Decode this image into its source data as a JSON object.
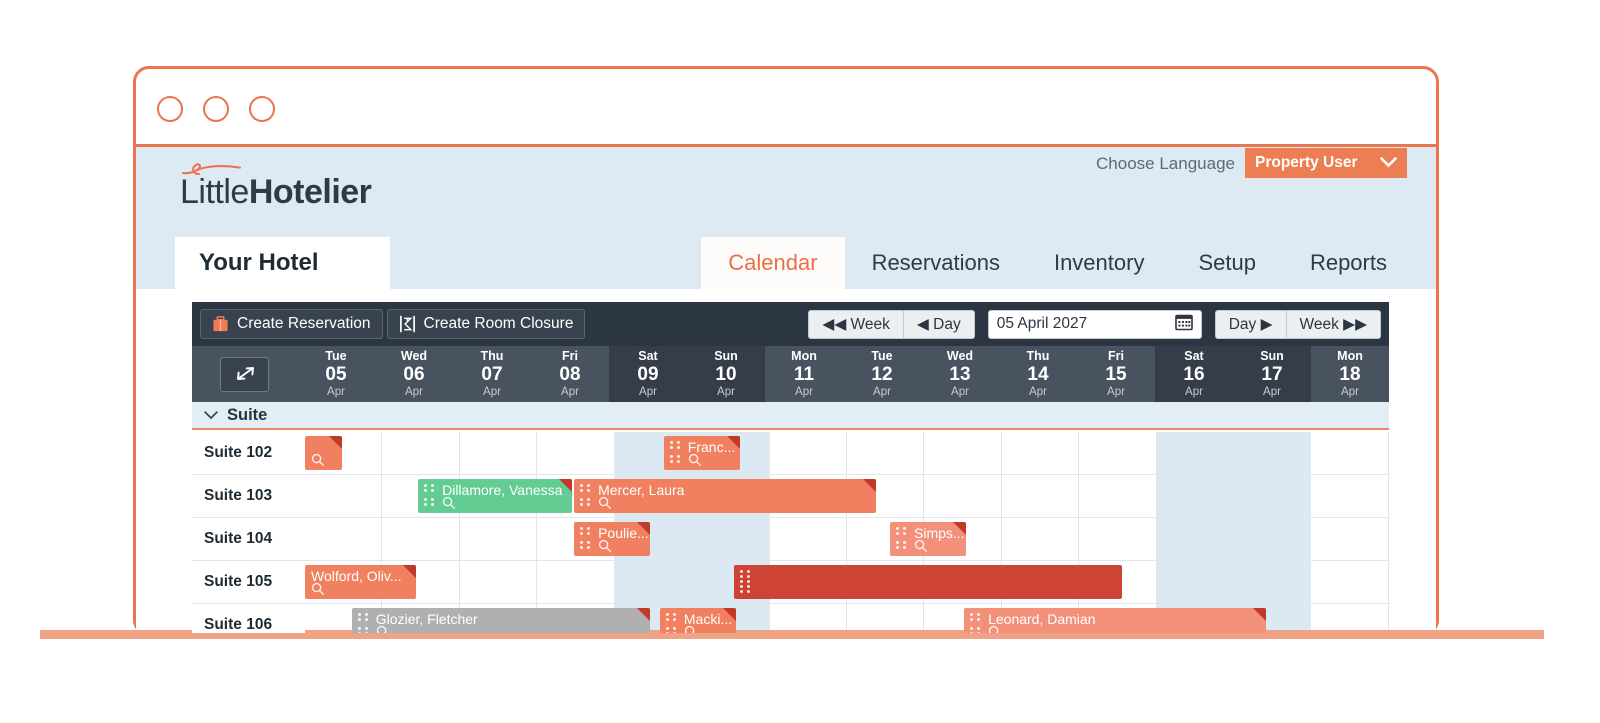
{
  "window": {
    "dots": [
      "close-dot",
      "minimize-dot",
      "maximize-dot"
    ]
  },
  "header": {
    "logo_light": "Little",
    "logo_bold": "Hotelier",
    "language_label": "Choose Language",
    "flag": "uk-flag-icon",
    "user_button": "Property User",
    "user_chevron": "⌄",
    "hotel_tab": "Your Hotel",
    "nav": [
      {
        "label": "Calendar",
        "active": true
      },
      {
        "label": "Reservations",
        "active": false
      },
      {
        "label": "Inventory",
        "active": false
      },
      {
        "label": "Setup",
        "active": false
      },
      {
        "label": "Reports",
        "active": false
      }
    ]
  },
  "toolbar": {
    "create_reservation": "Create Reservation",
    "create_room_closure": "Create Room Closure",
    "prev_week": "◀◀ Week",
    "prev_day": "◀ Day",
    "date_value": "05 April 2027",
    "calendar_icon": "calendar-icon",
    "next_day": "Day ▶",
    "next_week": "Week ▶▶"
  },
  "calendar": {
    "expand_icon": "expand-arrows-icon",
    "group": {
      "chevron": "⌄",
      "name": "Suite"
    },
    "days": [
      {
        "dow": "Tue",
        "num": "05",
        "mon": "Apr",
        "weekend": false
      },
      {
        "dow": "Wed",
        "num": "06",
        "mon": "Apr",
        "weekend": false
      },
      {
        "dow": "Thu",
        "num": "07",
        "mon": "Apr",
        "weekend": false
      },
      {
        "dow": "Fri",
        "num": "08",
        "mon": "Apr",
        "weekend": false
      },
      {
        "dow": "Sat",
        "num": "09",
        "mon": "Apr",
        "weekend": true
      },
      {
        "dow": "Sun",
        "num": "10",
        "mon": "Apr",
        "weekend": true
      },
      {
        "dow": "Mon",
        "num": "11",
        "mon": "Apr",
        "weekend": false
      },
      {
        "dow": "Tue",
        "num": "12",
        "mon": "Apr",
        "weekend": false
      },
      {
        "dow": "Wed",
        "num": "13",
        "mon": "Apr",
        "weekend": false
      },
      {
        "dow": "Thu",
        "num": "14",
        "mon": "Apr",
        "weekend": false
      },
      {
        "dow": "Fri",
        "num": "15",
        "mon": "Apr",
        "weekend": false
      },
      {
        "dow": "Sat",
        "num": "16",
        "mon": "Apr",
        "weekend": true
      },
      {
        "dow": "Sun",
        "num": "17",
        "mon": "Apr",
        "weekend": true
      },
      {
        "dow": "Mon",
        "num": "18",
        "mon": "Apr",
        "weekend": false
      }
    ],
    "rows": [
      {
        "room": "Suite 102",
        "bookings": [
          {
            "label": "",
            "start": 0,
            "span": 0.5,
            "color": "c-salmon",
            "handle": false,
            "corner": true,
            "mag": true
          },
          {
            "label": "Franc...",
            "start": 4.6,
            "span": 1.0,
            "color": "c-salmon",
            "handle": true,
            "corner": true,
            "mag": true
          }
        ]
      },
      {
        "room": "Suite 103",
        "bookings": [
          {
            "label": "Dillamore, Vanessa",
            "start": 1.45,
            "span": 2.0,
            "color": "c-green",
            "handle": true,
            "corner": true,
            "mag": true
          },
          {
            "label": "Mercer, Laura",
            "start": 3.45,
            "span": 3.9,
            "color": "c-salmon",
            "handle": true,
            "corner": true,
            "mag": true
          }
        ]
      },
      {
        "room": "Suite 104",
        "bookings": [
          {
            "label": "Poulie...",
            "start": 3.45,
            "span": 1.0,
            "color": "c-salmon",
            "handle": true,
            "corner": true,
            "mag": true
          },
          {
            "label": "Simps...",
            "start": 7.5,
            "span": 1.0,
            "color": "c-salmon-l",
            "handle": true,
            "corner": true,
            "mag": true
          }
        ]
      },
      {
        "room": "Suite 105",
        "bookings": [
          {
            "label": "Wolford, Oliv...",
            "start": 0,
            "span": 1.45,
            "color": "c-salmon",
            "handle": false,
            "corner": true,
            "mag": true
          },
          {
            "label": "",
            "start": 5.5,
            "span": 5.0,
            "color": "c-darkred",
            "handle": true,
            "corner": false,
            "mag": false
          }
        ]
      },
      {
        "room": "Suite 106",
        "bookings": [
          {
            "label": "Glozier, Fletcher",
            "start": 0.6,
            "span": 3.85,
            "color": "c-grey",
            "handle": true,
            "corner": true,
            "mag": true
          },
          {
            "label": "Macki...",
            "start": 4.55,
            "span": 1.0,
            "color": "c-salmon",
            "handle": true,
            "corner": true,
            "mag": true
          },
          {
            "label": "Leonard, Damian",
            "start": 8.45,
            "span": 3.9,
            "color": "c-salmon-l",
            "handle": true,
            "corner": true,
            "mag": true
          }
        ]
      }
    ]
  }
}
